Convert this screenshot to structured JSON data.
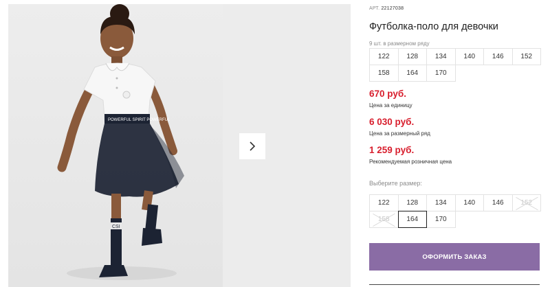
{
  "gallery": {
    "main_photo": "girl-in-polo-shirt-and-tulle-skirt-photo",
    "skirt_text": "POWERFUL SPIRIT POWERFUL",
    "sock_text": "CSI",
    "next_arrow_icon": "chevron-right-icon"
  },
  "product": {
    "article_label": "АРТ.",
    "article_number": "22127038",
    "title": "Футболка-поло для девочки",
    "series_note": "9 шт. в размерном ряду",
    "series_sizes": [
      "122",
      "128",
      "134",
      "140",
      "146",
      "152",
      "158",
      "164",
      "170"
    ]
  },
  "prices": [
    {
      "value": "670 руб.",
      "label": "Цена за единицу"
    },
    {
      "value": "6 030 руб.",
      "label": "Цена за размерный ряд"
    },
    {
      "value": "1 259 руб.",
      "label": "Рекомендуемая розничная цена"
    }
  ],
  "size_selector": {
    "label": "Выберите размер:",
    "sizes": [
      {
        "size": "122",
        "state": "available"
      },
      {
        "size": "128",
        "state": "available"
      },
      {
        "size": "134",
        "state": "available"
      },
      {
        "size": "140",
        "state": "available"
      },
      {
        "size": "146",
        "state": "available"
      },
      {
        "size": "152",
        "state": "disabled"
      },
      {
        "size": "158",
        "state": "disabled"
      },
      {
        "size": "164",
        "state": "selected"
      },
      {
        "size": "170",
        "state": "available"
      }
    ]
  },
  "order_button": {
    "label": "ОФОРМИТЬ ЗАКАЗ"
  },
  "colors": {
    "price_red": "#d81e2d",
    "order_purple": "#8a6ca5",
    "skirt_navy": "#1c2333"
  }
}
